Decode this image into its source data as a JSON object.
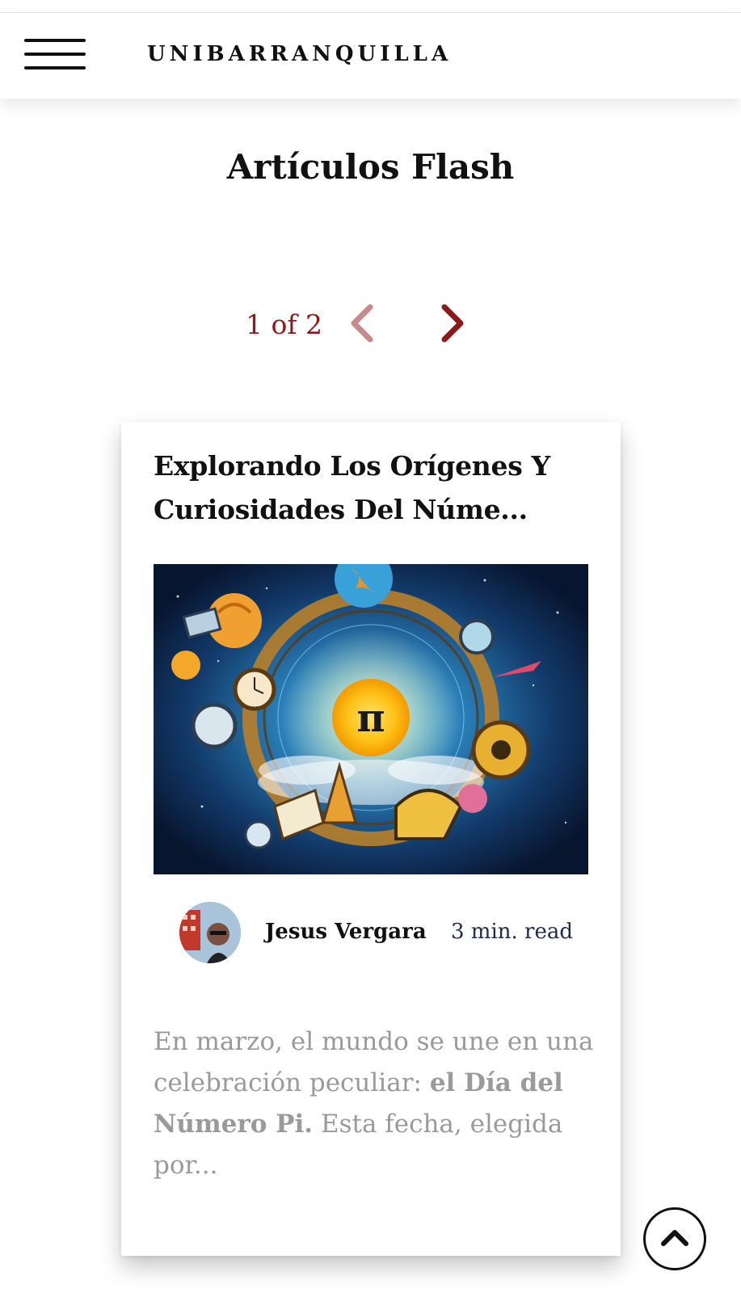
{
  "header": {
    "brand": "UNIBARRANQUILLA",
    "menu_icon": "hamburger-menu-icon"
  },
  "section": {
    "title": "Artículos Flash"
  },
  "pager": {
    "count_label": "1 of 2",
    "prev_icon": "chevron-left-icon",
    "next_icon": "chevron-right-icon",
    "prev_color": "#c98a8a",
    "next_color": "#8b1a1a"
  },
  "article": {
    "title": "Explorando Los Orígenes Y Curiosidades Del Núme...",
    "image_symbol": "π",
    "author": "Jesus Vergara",
    "read_time": "3 min. read",
    "excerpt_part1": "En marzo, el mundo se une en una celebración peculiar: ",
    "excerpt_bold": "el Día del Número Pi.",
    "excerpt_part2": " Esta fecha, elegida por..."
  },
  "scroll_top": {
    "icon": "chevron-up-icon"
  },
  "colors": {
    "accent": "#8b1a1a",
    "text": "#111111",
    "muted": "#9a9a9a"
  }
}
